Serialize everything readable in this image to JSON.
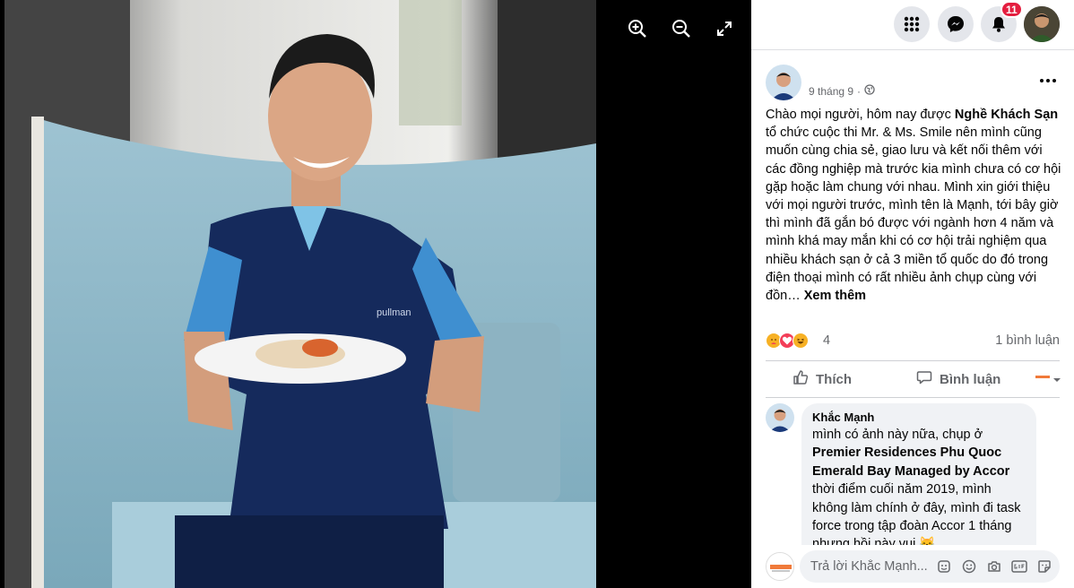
{
  "viewer": {
    "toolbar": {
      "zoom_in": "zoom-in-icon",
      "zoom_out": "zoom-out-icon",
      "fullscreen": "fullscreen-icon"
    },
    "photo": {
      "shirt_text": "pullman"
    }
  },
  "nav": {
    "notification_count": "11",
    "icons": [
      "menu-grid-icon",
      "messenger-icon",
      "bell-icon",
      "profile-avatar"
    ]
  },
  "post": {
    "author_name": "",
    "date": "9 tháng 9",
    "privacy_dot": "·",
    "text_segments": {
      "p1": "Chào mọi người, hôm nay được ",
      "bold1": "Nghề Khách Sạn",
      "p2": " tổ chức cuộc thi Mr. & Ms. Smile nên mình cũng muốn cùng chia sẻ, giao lưu và kết nối thêm với các đồng nghiệp mà trước kia mình chưa có cơ hội gặp hoặc làm chung với nhau. Mình xin giới thiệu với mọi người trước, mình tên là Mạnh, tới bây giờ thì mình đã gắn bó được với ngành hơn 4 năm và mình khá may mắn khi có cơ hội trải nghiệm qua nhiều khách sạn ở cả 3 miền tổ quốc do đó trong điện thoại mình có rất nhiều ảnh chụp cùng với đồn… ",
      "see_more": "Xem thêm"
    },
    "reaction_count": "4",
    "comment_count": "1 bình luận",
    "like_label": "Thích",
    "comment_label": "Bình luận"
  },
  "comment": {
    "author": "Khắc Mạnh",
    "line1": "mình có ảnh này nữa, chụp ở",
    "bold": "Premier Residences Phu Quoc Emerald Bay Managed by Accor",
    "line2": "thời điểm cuối năm 2019, mình không làm chính ở đây, mình đi task force trong tập đoàn Accor 1 tháng nhưng hồi này vui 😹"
  },
  "reply": {
    "placeholder": "Trả lời Khắc Mạnh..."
  },
  "colors": {
    "accent_red": "#e41e3f",
    "text_secondary": "#65676b",
    "bubble_bg": "#f0f2f5"
  }
}
